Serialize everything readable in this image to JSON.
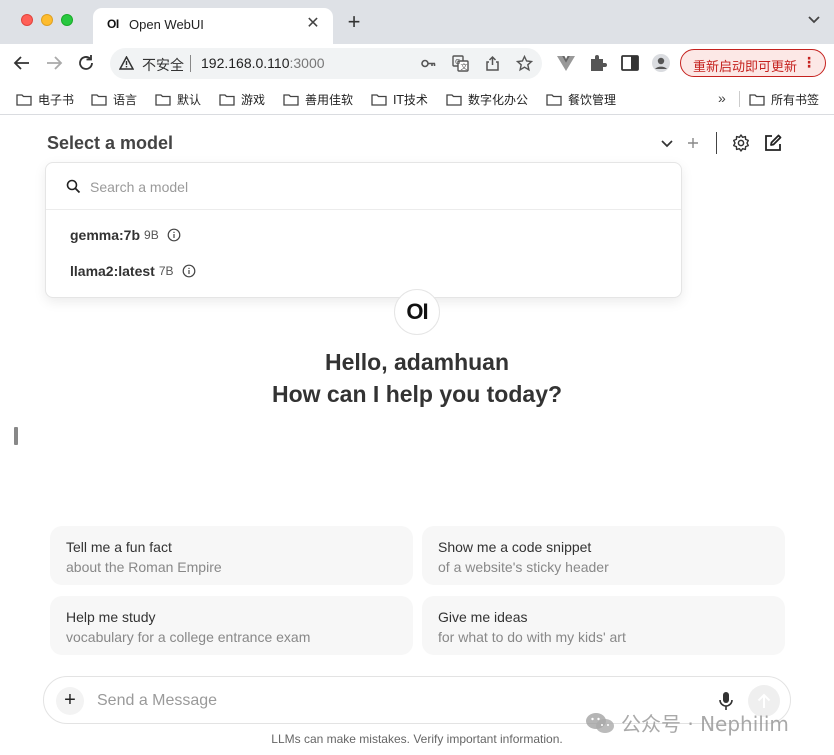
{
  "browser": {
    "tab": {
      "favicon_text": "OI",
      "title": "Open WebUI"
    },
    "omnibox": {
      "security_label": "不安全",
      "host": "192.168.0.110",
      "port": ":3000"
    },
    "update_button": "重新启动即可更新",
    "bookmarks": [
      "电子书",
      "语言",
      "默认",
      "游戏",
      "善用佳软",
      "IT技术",
      "数字化办公",
      "餐饮管理"
    ],
    "bookmarks_overflow": "»",
    "all_bookmarks": "所有书签"
  },
  "app": {
    "model_selector": {
      "title": "Select a model",
      "search_placeholder": "Search a model"
    },
    "models": [
      {
        "name": "gemma:7b",
        "size": "9B"
      },
      {
        "name": "llama2:latest",
        "size": "7B"
      }
    ],
    "logo_text": "OI",
    "greeting": {
      "line1": "Hello, adamhuan",
      "line2": "How can I help you today?"
    },
    "suggestions": [
      {
        "title": "Tell me a fun fact",
        "subtitle": "about the Roman Empire"
      },
      {
        "title": "Show me a code snippet",
        "subtitle": "of a website's sticky header"
      },
      {
        "title": "Help me study",
        "subtitle": "vocabulary for a college entrance exam"
      },
      {
        "title": "Give me ideas",
        "subtitle": "for what to do with my kids' art"
      }
    ],
    "composer": {
      "placeholder": "Send a Message",
      "plus": "+"
    },
    "disclaimer": "LLMs can make mistakes. Verify important information."
  },
  "watermark": "公众号 · Nephilim",
  "colors": {
    "update_accent": "#c5221f",
    "tabbar": "#dee1e6",
    "suggestion_bg": "#f7f7f7"
  }
}
